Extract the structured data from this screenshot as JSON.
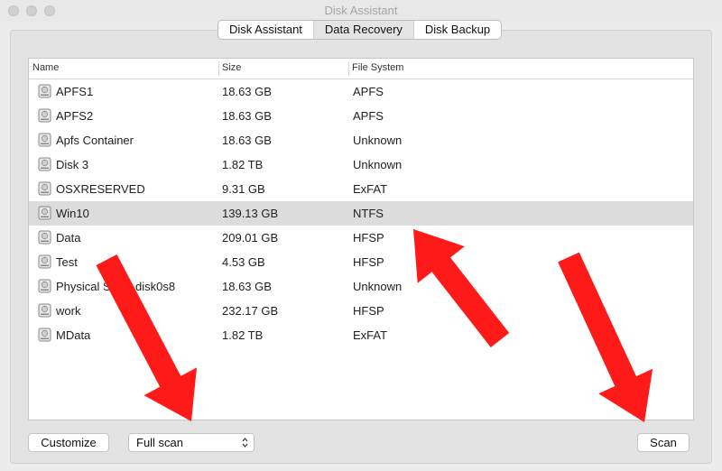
{
  "window": {
    "title": "Disk Assistant"
  },
  "tabs": [
    {
      "label": "Disk Assistant",
      "selected": false
    },
    {
      "label": "Data Recovery",
      "selected": true
    },
    {
      "label": "Disk Backup",
      "selected": false
    }
  ],
  "table": {
    "headers": {
      "name": "Name",
      "size": "Size",
      "fs": "File System"
    },
    "rows": [
      {
        "name": "APFS1",
        "size": "18.63 GB",
        "fs": "APFS",
        "selected": false
      },
      {
        "name": "APFS2",
        "size": "18.63 GB",
        "fs": "APFS",
        "selected": false
      },
      {
        "name": "Apfs Container",
        "size": "18.63 GB",
        "fs": "Unknown",
        "selected": false
      },
      {
        "name": "Disk 3",
        "size": "1.82 TB",
        "fs": "Unknown",
        "selected": false
      },
      {
        "name": "OSXRESERVED",
        "size": "9.31 GB",
        "fs": "ExFAT",
        "selected": false
      },
      {
        "name": "Win10",
        "size": "139.13 GB",
        "fs": "NTFS",
        "selected": true
      },
      {
        "name": "Data",
        "size": "209.01 GB",
        "fs": "HFSP",
        "selected": false
      },
      {
        "name": "Test",
        "size": "4.53 GB",
        "fs": "HFSP",
        "selected": false
      },
      {
        "name": "Physical S",
        "name_tail": "disk0s8",
        "size": "18.63 GB",
        "fs": "Unknown",
        "selected": false
      },
      {
        "name": "work",
        "size": "232.17 GB",
        "fs": "HFSP",
        "selected": false
      },
      {
        "name": "MData",
        "size": "1.82 TB",
        "fs": "ExFAT",
        "selected": false
      }
    ]
  },
  "footer": {
    "customize_label": "Customize",
    "scan_mode": "Full scan",
    "scan_label": "Scan"
  },
  "colors": {
    "arrow": "#ff1a1a",
    "selected_row": "#dcdcdc"
  }
}
